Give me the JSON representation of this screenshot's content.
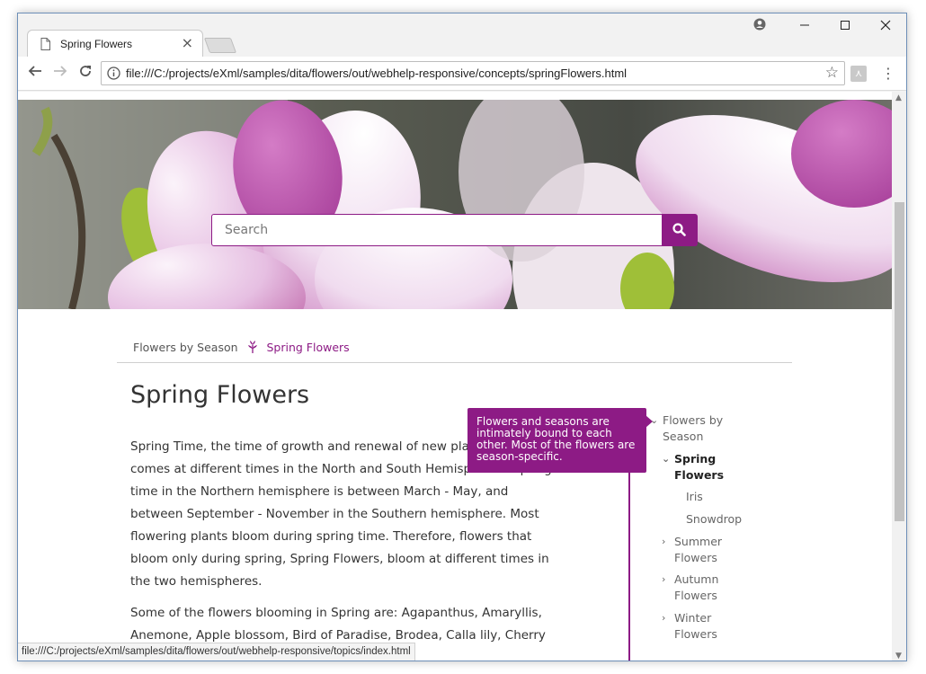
{
  "browser": {
    "tab_title": "Spring Flowers",
    "tab_close": "×",
    "url": "file:///C:/projects/eXml/samples/dita/flowers/out/webhelp-responsive/concepts/springFlowers.html",
    "status_url": "file:///C:/projects/eXml/samples/dita/flowers/out/webhelp-responsive/topics/index.html"
  },
  "search": {
    "placeholder": "Search"
  },
  "breadcrumb": {
    "parent": "Flowers by Season",
    "current": "Spring Flowers"
  },
  "page": {
    "title": "Spring Flowers",
    "paragraphs": [
      "Spring Time, the time of growth and renewal of new plant life. Spring comes at different times in the North and South Hemispheres. Spring time in the Northern hemisphere is between March - May, and between September - November in the Southern hemisphere. Most flowering plants bloom during spring time. Therefore, flowers that bloom only during spring, Spring Flowers, bloom at different times in the two hemispheres.",
      "Some of the flowers blooming in Spring are: Agapanthus, Amaryllis, Anemone, Apple blossom, Bird of Paradise, Brodea, Calla lily, Cherry blossom, Daffodil, Delwood,"
    ]
  },
  "tooltip": {
    "text": "Flowers and seasons are intimately bound to each other. Most of the flowers are season-specific."
  },
  "toc": {
    "items": [
      {
        "label": "Flowers by Season",
        "arrow": "⌄"
      },
      {
        "label": "Spring Flowers",
        "arrow": "⌄"
      },
      {
        "label": "Iris"
      },
      {
        "label": "Snowdrop"
      },
      {
        "label": "Summer Flowers",
        "arrow": "›"
      },
      {
        "label": "Autumn Flowers",
        "arrow": "›"
      },
      {
        "label": "Winter Flowers",
        "arrow": "›"
      }
    ]
  },
  "colors": {
    "accent": "#8d1b85"
  }
}
